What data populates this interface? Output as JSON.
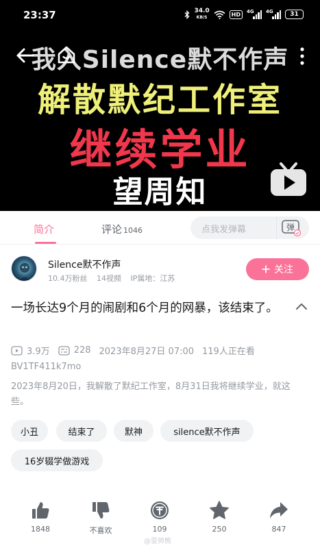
{
  "status_bar": {
    "time": "23:37",
    "net_speed_value": "34.0",
    "net_speed_unit": "KB/S",
    "hd_badge": "HD",
    "signal_1": "4G",
    "signal_2": "4G",
    "battery": "31"
  },
  "video": {
    "cover_lines": [
      "我入Silence默不作声",
      "解散默纪工作室",
      "继续学业",
      "望周知"
    ],
    "tv_icon": "bilibili-tv-play-icon"
  },
  "tabs": {
    "intro": "简介",
    "comments": "评论",
    "comments_count": "1046"
  },
  "danmaku": {
    "placeholder": "点我发弹幕",
    "button": "弹"
  },
  "uploader": {
    "name": "Silence默不作声",
    "fans": "10.4万粉丝",
    "videos": "14视频",
    "ip": "IP属地：江苏",
    "follow_label": "关注"
  },
  "title": "一场长达9个月的闹剧和6个月的网暴，该结束了。",
  "stats": {
    "views": "3.9万",
    "danmaku": "228",
    "datetime": "2023年8月27日 07:00",
    "watching": "119人正在看"
  },
  "bvid": "BV1TF411k7mo",
  "description": "2023年8月20日，我解散了默纪工作室，8月31日我将继续学业，就这些。",
  "tags": [
    "小丑",
    "结束了",
    "默神",
    "silence默不作声",
    "16岁辍学做游戏"
  ],
  "actions": [
    {
      "name": "like",
      "icon": "thumbs-up-icon",
      "label": "1848"
    },
    {
      "name": "dislike",
      "icon": "thumbs-down-icon",
      "label": "不喜欢"
    },
    {
      "name": "coin",
      "icon": "coin-icon",
      "label": "109"
    },
    {
      "name": "favorite",
      "icon": "star-icon",
      "label": "250"
    },
    {
      "name": "share",
      "icon": "share-icon",
      "label": "847"
    }
  ],
  "watermark": "@亚帅熊",
  "colors": {
    "accent": "#fb7299",
    "text": "#18191c",
    "muted": "#9499a0",
    "action_icon": "#61666d"
  }
}
